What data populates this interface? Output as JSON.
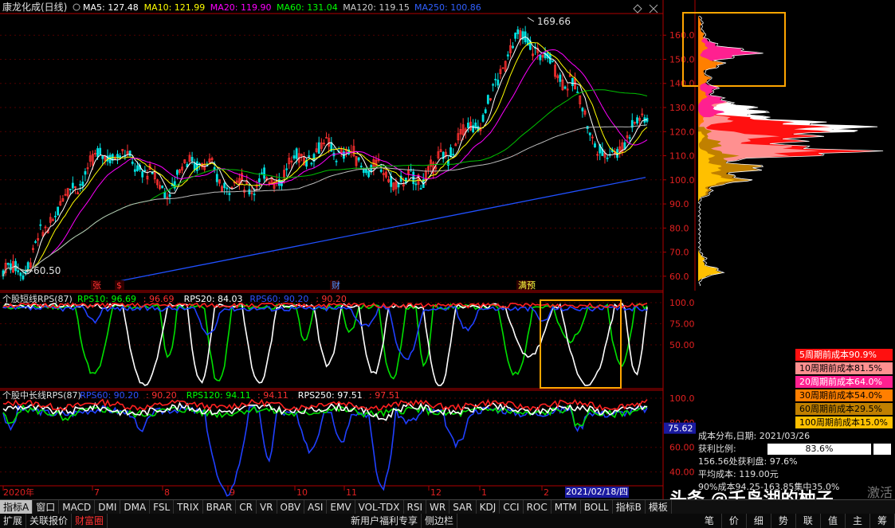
{
  "chart_data": [
    {
      "type": "candlestick",
      "title": "康龙化成(日线)",
      "indicators": [
        {
          "name": "MA5",
          "value": "127.48",
          "color": "#ffffff"
        },
        {
          "name": "MA10",
          "value": "121.99",
          "color": "#ffff00"
        },
        {
          "name": "MA20",
          "value": "119.90",
          "color": "#ff00ff"
        },
        {
          "name": "MA60",
          "value": "131.04",
          "color": "#00ff00"
        },
        {
          "name": "MA120",
          "value": "119.15",
          "color": "#cccccc"
        },
        {
          "name": "MA250",
          "value": "100.86",
          "color": "#3060ff"
        }
      ],
      "ylim": [
        55,
        168
      ],
      "yticks": [
        "160.0",
        "150.0",
        "140.0",
        "130.0",
        "120.0",
        "110.0",
        "100.0",
        "90.0",
        "80.0",
        "70.0",
        "60.0"
      ],
      "annotations": {
        "high": "169.66",
        "low": "60.50"
      },
      "event_markers": [
        "张",
        "$",
        "财",
        "满预"
      ]
    },
    {
      "type": "line",
      "title": "个股短线RPS(87)",
      "legend": [
        {
          "label": "RPS10: 96.69",
          "color": "#00ff00"
        },
        {
          "label": ": 96.69",
          "color": "#ff3030"
        },
        {
          "label": "RPS20: 84.03",
          "color": "#ffffff"
        },
        {
          "label": "RPS60: 90.20",
          "color": "#3050ff"
        },
        {
          "label": ": 90.20",
          "color": "#ff3030"
        }
      ],
      "ylim": [
        0,
        100
      ],
      "yticks": [
        "100.0",
        "75.00",
        "50.00"
      ]
    },
    {
      "type": "line",
      "title": "个股中长线RPS(87)",
      "legend": [
        {
          "label": "RPS60: 90.20",
          "color": "#3050ff"
        },
        {
          "label": ": 90.20",
          "color": "#ff3030"
        },
        {
          "label": "RPS120: 94.11",
          "color": "#00ff00"
        },
        {
          "label": ": 94.11",
          "color": "#ff3030"
        },
        {
          "label": "RPS250: 97.51",
          "color": "#ffffff"
        },
        {
          "label": ": 97.51",
          "color": "#ff3030"
        }
      ],
      "ylim": [
        30,
        100
      ],
      "yticks": [
        "100.0",
        "80.00",
        "60.00",
        "40.00"
      ],
      "current": "75.62"
    }
  ],
  "xaxis": [
    "2020年",
    "7",
    "8",
    "9",
    "10",
    "11",
    "12",
    "1",
    "2"
  ],
  "date_flag": "2021/02/18/四",
  "cost_distribution": {
    "legend": [
      {
        "label": "5周期前成本90.9%",
        "color": "#ff1010"
      },
      {
        "label": "10周期前成本81.5%",
        "color": "#ff9090"
      },
      {
        "label": "20周期前成本64.0%",
        "color": "#ff2090"
      },
      {
        "label": "30周期前成本54.0%",
        "color": "#ff7f00"
      },
      {
        "label": "60周期前成本29.5%",
        "color": "#c08000"
      },
      {
        "label": "100周期前成本15.0%",
        "color": "#ffc000"
      }
    ],
    "date_line": "成本分布,日期: 2021/03/26",
    "profit_label": "获利比例:",
    "profit_value": "83.6%",
    "profit_point": "156.56处获利盘: 97.6%",
    "avg_cost": "平均成本: 119.00元",
    "concentration": "90%成本94.25-163.85集中35.0%"
  },
  "toolbar1": [
    "指标A",
    "窗口",
    "MACD",
    "DMI",
    "DMA",
    "FSL",
    "TRIX",
    "BRAR",
    "CR",
    "VR",
    "OBV",
    "ASI",
    "EMV",
    "VOL-TDX",
    "RSI",
    "WR",
    "SAR",
    "KDJ",
    "CCI",
    "ROC",
    "MTM",
    "BOLL",
    "指标B",
    "模板"
  ],
  "toolbar2": [
    "扩展",
    "关联报价",
    "财富圈",
    "新用户福利专享",
    "侧边栏"
  ],
  "toolbar2_right": [
    "笔",
    "价",
    "细",
    "势",
    "联",
    "值",
    "主",
    "筹"
  ],
  "watermark": "头条 @千岛湖的柚子",
  "activate_text": "激活"
}
